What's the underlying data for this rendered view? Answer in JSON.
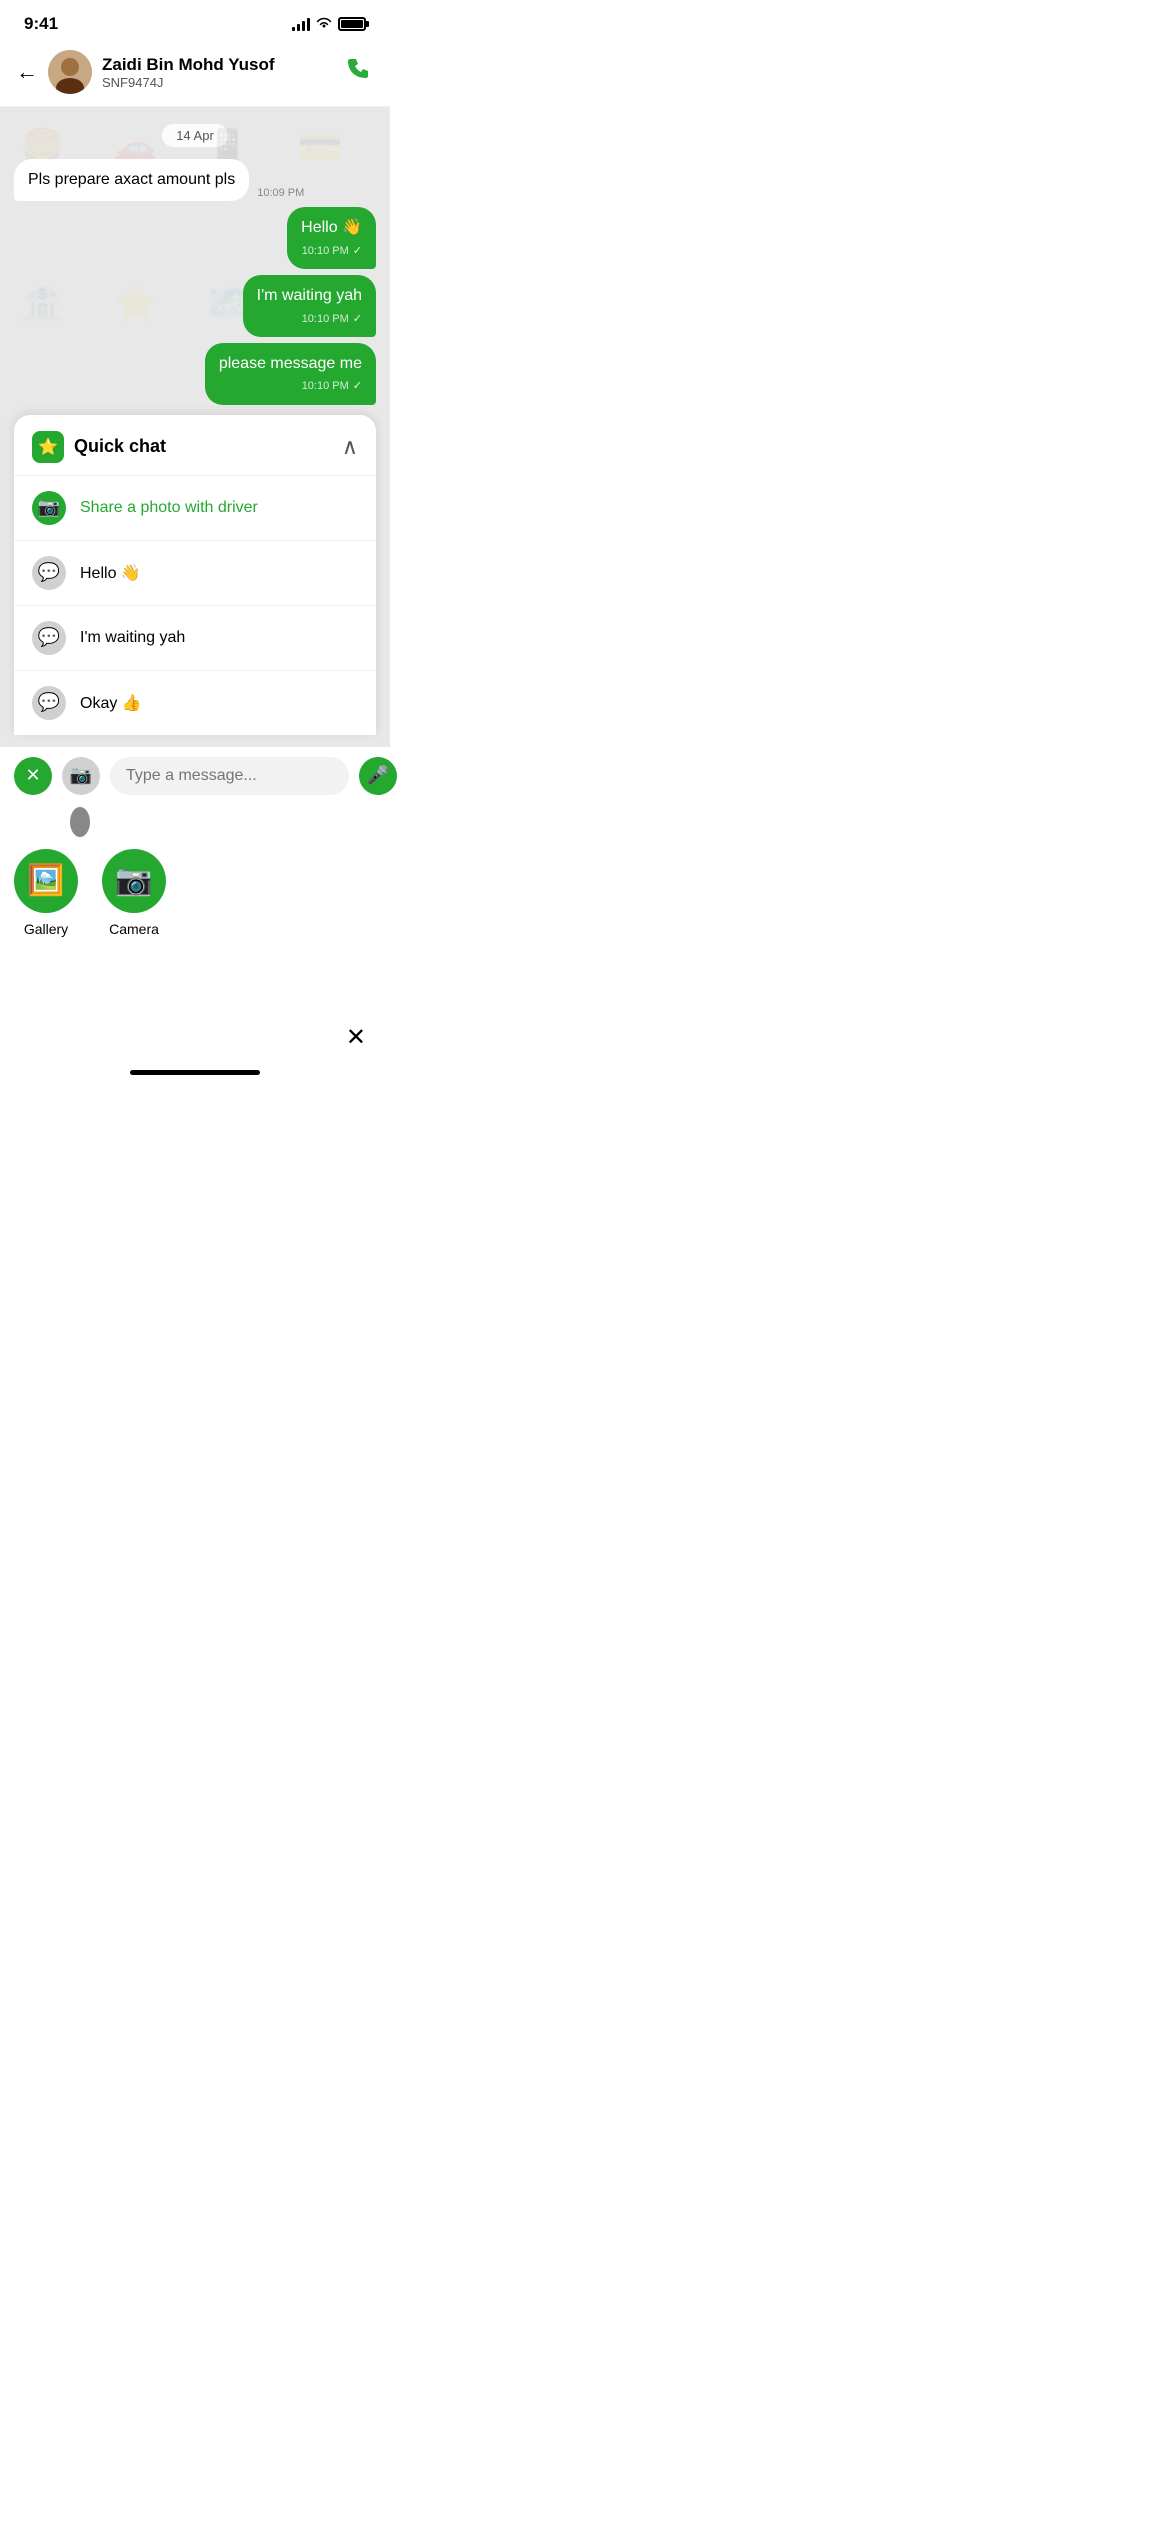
{
  "status": {
    "time": "9:41",
    "signal": 4,
    "wifi": true,
    "battery": 100
  },
  "header": {
    "back_label": "←",
    "contact_name": "Zaidi Bin Mohd Yusof",
    "contact_plate": "SNF9474J",
    "call_icon": "📞"
  },
  "chat": {
    "date_label": "14 Apr",
    "messages": [
      {
        "type": "received",
        "text": "Pls prepare axact amount pls",
        "time": "10:09 PM"
      },
      {
        "type": "sent",
        "text": "Hello 👋",
        "time": "10:10 PM",
        "check": "✓"
      },
      {
        "type": "sent",
        "text": "I'm waiting yah",
        "time": "10:10 PM",
        "check": "✓"
      },
      {
        "type": "sent",
        "text": "please message me",
        "time": "10:10 PM",
        "check": "✓"
      }
    ]
  },
  "quick_chat": {
    "title": "Quick chat",
    "star_icon": "⭐",
    "collapse_icon": "∧",
    "items": [
      {
        "icon_type": "green_cam",
        "icon": "📷",
        "text": "Share a photo with driver",
        "text_color": "green"
      },
      {
        "icon_type": "gray_bubble",
        "icon": "💬",
        "text": "Hello 👋",
        "text_color": "normal"
      },
      {
        "icon_type": "gray_bubble",
        "icon": "💬",
        "text": "I'm waiting yah",
        "text_color": "normal"
      },
      {
        "icon_type": "gray_bubble",
        "icon": "💬",
        "text": "Okay 👍",
        "text_color": "normal"
      }
    ]
  },
  "input": {
    "placeholder": "Type a message...",
    "close_icon": "✕",
    "camera_icon": "📷",
    "mic_icon": "🎤"
  },
  "media_options": [
    {
      "icon": "🖼️",
      "label": "Gallery"
    },
    {
      "icon": "📷",
      "label": "Camera"
    }
  ],
  "bottom": {
    "close_icon": "✕"
  }
}
